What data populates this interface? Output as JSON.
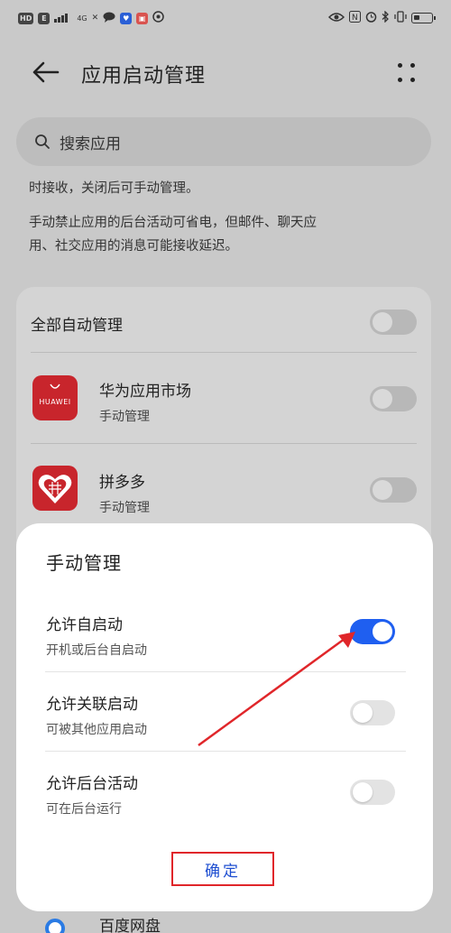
{
  "status_bar": {
    "left_badges": [
      "HD",
      "E",
      "4G",
      "✕"
    ],
    "right_icons": [
      "eye-icon",
      "nfc-icon",
      "alarm-icon",
      "bluetooth-icon",
      "vibrate-icon",
      "battery-icon"
    ]
  },
  "header": {
    "title": "应用启动管理"
  },
  "search": {
    "placeholder": "搜索应用"
  },
  "description": {
    "line1": "时接收，关闭后可手动管理。",
    "line2": "手动禁止应用的后台活动可省电，但邮件、聊天应",
    "line3": "用、社交应用的消息可能接收延迟。"
  },
  "list": {
    "all_auto": "全部自动管理",
    "apps": [
      {
        "name": "华为应用市场",
        "mode": "手动管理",
        "icon_text": "HUAWEI"
      },
      {
        "name": "拼多多",
        "mode": "手动管理"
      }
    ],
    "peek_item": "百度网盘"
  },
  "dialog": {
    "title": "手动管理",
    "options": [
      {
        "label": "允许自启动",
        "desc": "开机或后台自启动",
        "enabled": true
      },
      {
        "label": "允许关联启动",
        "desc": "可被其他应用启动",
        "enabled": false
      },
      {
        "label": "允许后台活动",
        "desc": "可在后台运行",
        "enabled": false
      }
    ],
    "confirm_label": "确定"
  },
  "colors": {
    "toggle_on": "#1f5ff0",
    "annotation_red": "#e0262a",
    "app_red": "#c8252c"
  }
}
